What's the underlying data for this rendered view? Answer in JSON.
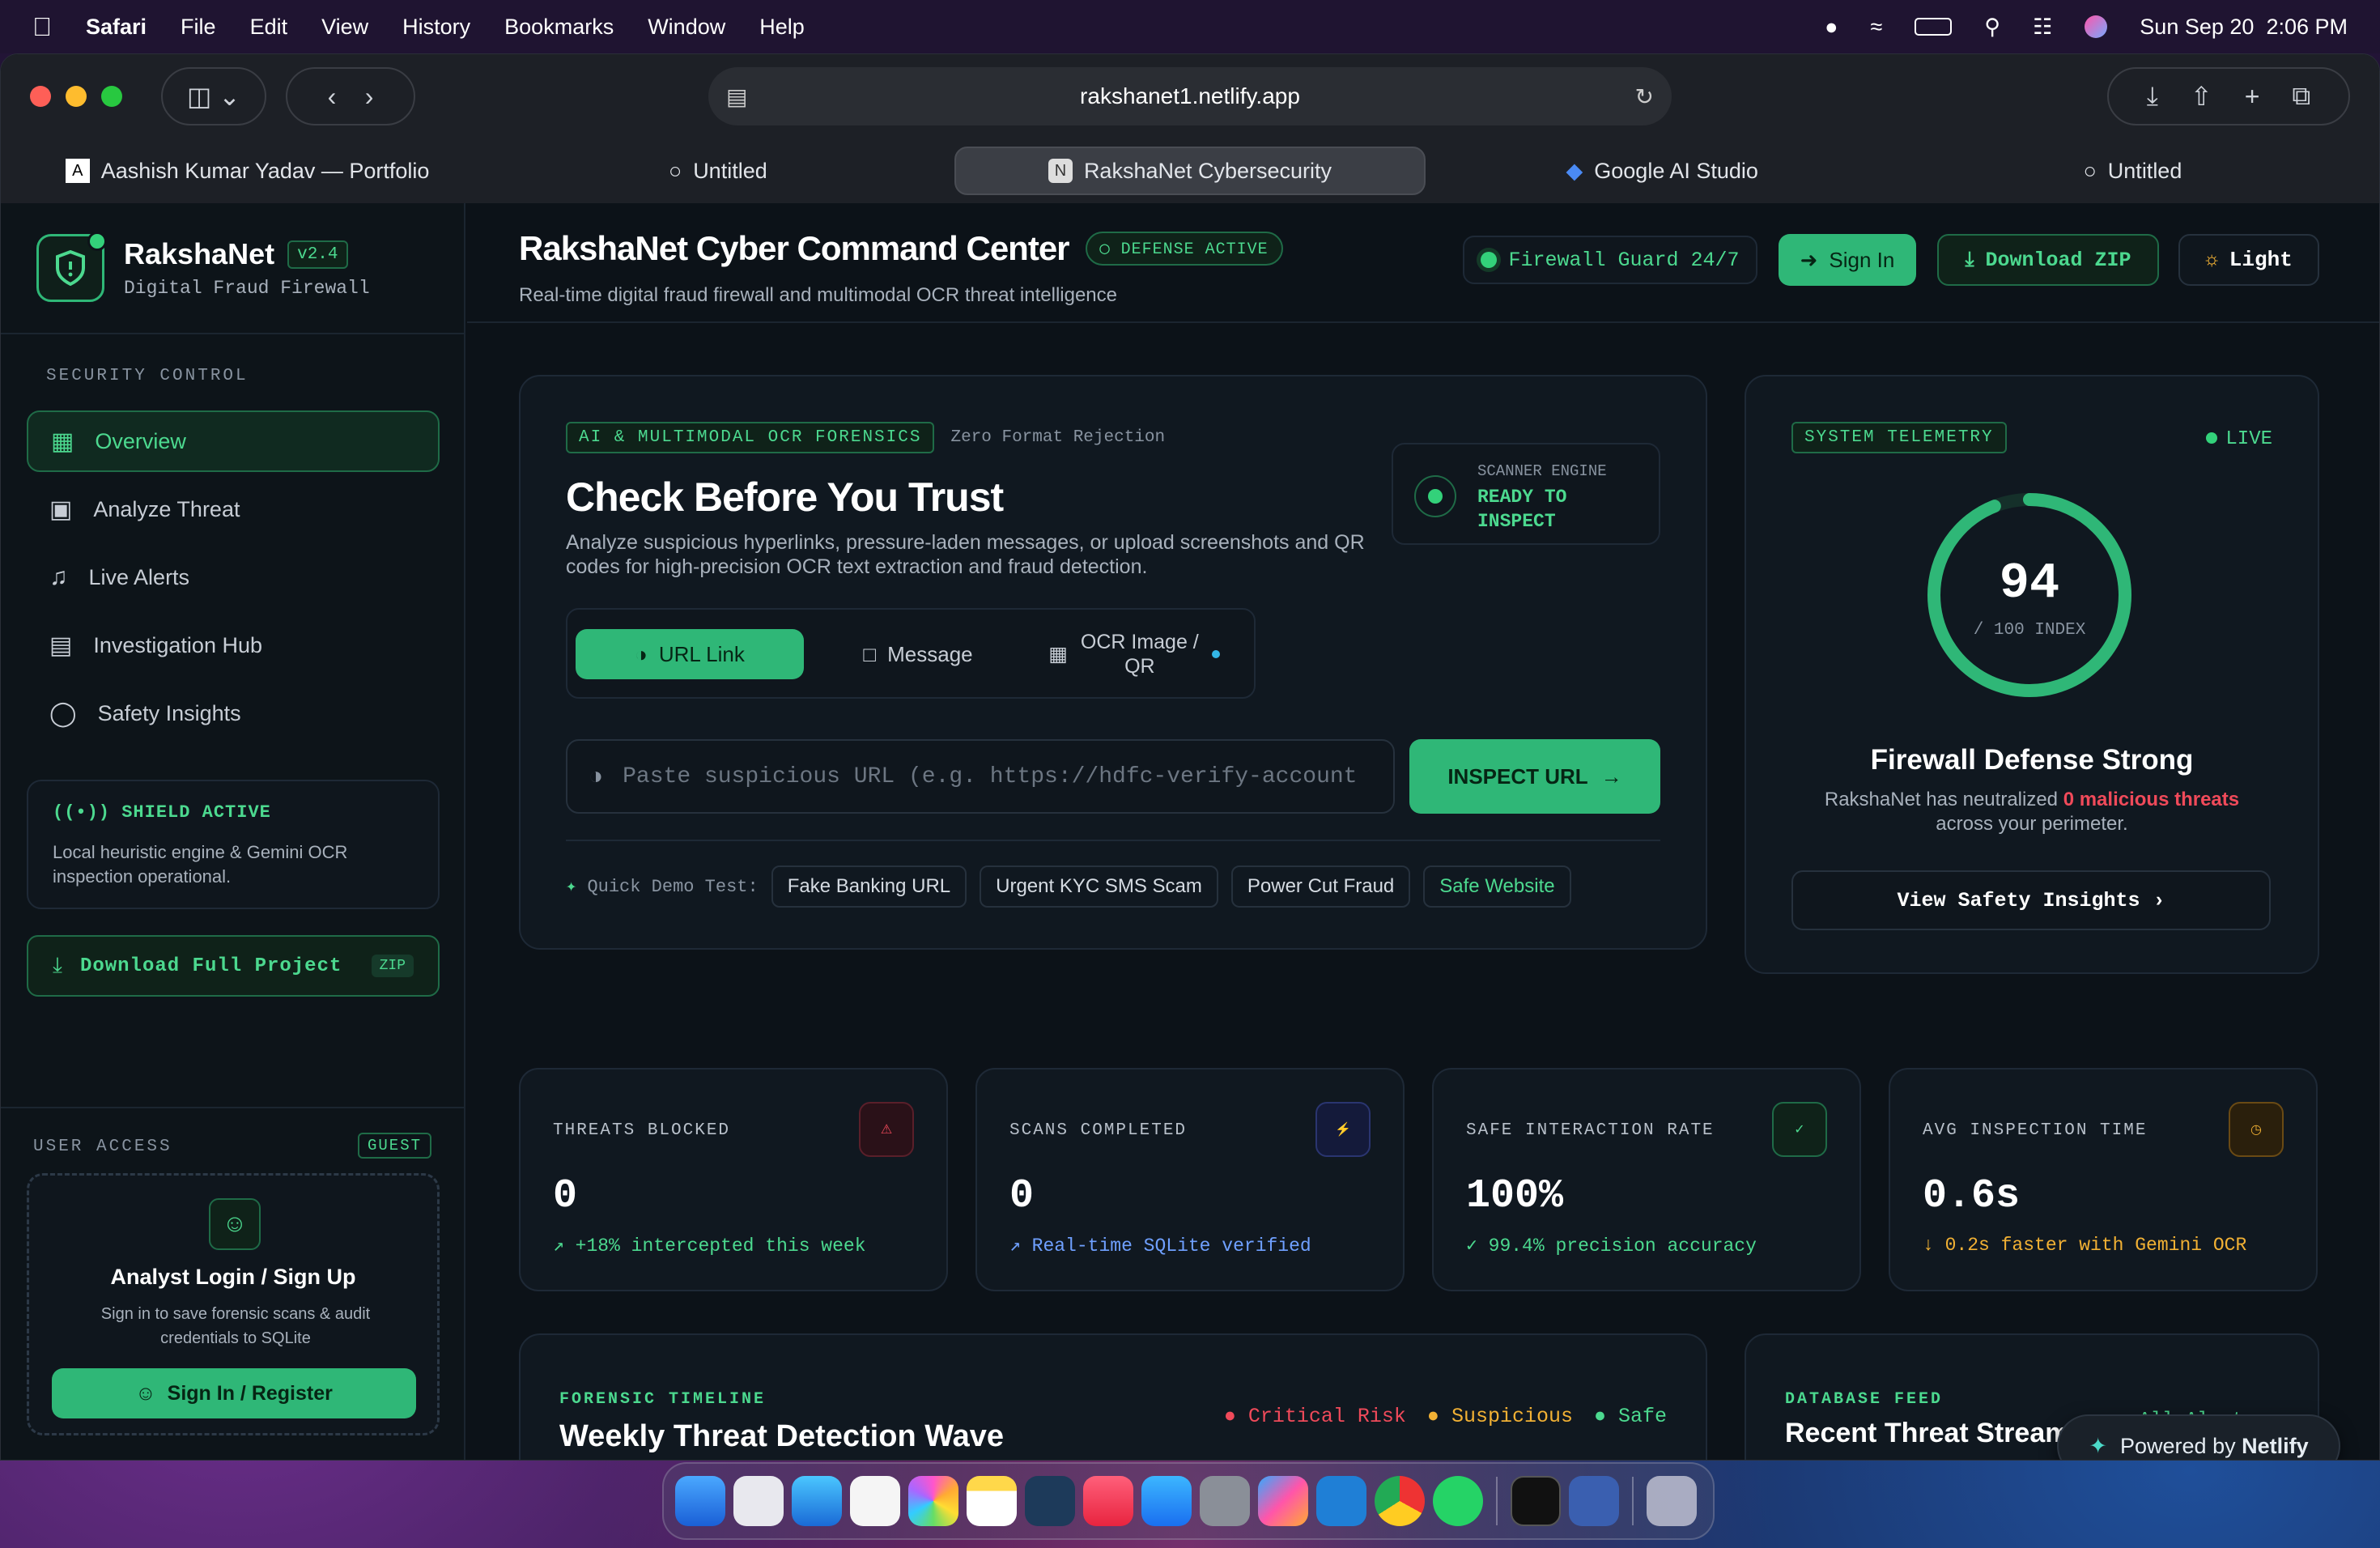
{
  "menubar": {
    "app": "Safari",
    "items": [
      "File",
      "Edit",
      "View",
      "History",
      "Bookmarks",
      "Window",
      "Help"
    ],
    "date": "Sun Sep 20",
    "time": "2:06 PM"
  },
  "browser": {
    "url": "rakshanet1.netlify.app",
    "tabs": [
      {
        "label": "Aashish Kumar Yadav — Portfolio",
        "favicon": "A"
      },
      {
        "label": "Untitled"
      },
      {
        "label": "RakshaNet Cybersecurity",
        "favicon": "N"
      },
      {
        "label": "Google AI Studio"
      },
      {
        "label": "Untitled"
      }
    ]
  },
  "brand": {
    "name": "RakshaNet",
    "version": "v2.4",
    "tagline": "Digital Fraud Firewall"
  },
  "sidebar": {
    "section_title": "SECURITY CONTROL",
    "items": [
      {
        "label": "Overview",
        "icon": "grid-icon"
      },
      {
        "label": "Analyze Threat",
        "icon": "scan-icon"
      },
      {
        "label": "Live Alerts",
        "icon": "bell-icon"
      },
      {
        "label": "Investigation Hub",
        "icon": "file-icon"
      },
      {
        "label": "Safety Insights",
        "icon": "bulb-icon"
      }
    ],
    "shield": {
      "title": "SHIELD ACTIVE",
      "text": "Local heuristic engine & Gemini OCR inspection operational."
    },
    "download": {
      "label": "Download Full Project",
      "tag": "ZIP"
    },
    "user": {
      "title": "USER ACCESS",
      "badge": "GUEST",
      "heading": "Analyst Login / Sign Up",
      "text": "Sign in to save forensic scans & audit credentials to SQLite",
      "button": "Sign In / Register"
    }
  },
  "header": {
    "title": "RakshaNet Cyber Command Center",
    "badge": "DEFENSE ACTIVE",
    "subtitle": "Real-time digital fraud firewall and multimodal OCR threat intelligence",
    "firewall": "Firewall Guard 24/7",
    "signin": "Sign In",
    "download": "Download ZIP",
    "theme": "Light"
  },
  "inspect": {
    "badge": "AI & MULTIMODAL OCR FORENSICS",
    "badge_note": "Zero Format Rejection",
    "title": "Check Before You Trust",
    "desc": "Analyze suspicious hyperlinks, pressure-laden messages, or upload screenshots and QR codes for high-precision OCR text extraction and fraud detection.",
    "engine": {
      "label": "SCANNER ENGINE",
      "status1": "READY TO",
      "status2": "INSPECT"
    },
    "tabs": [
      "URL Link",
      "Message",
      "OCR Image / QR"
    ],
    "placeholder": "Paste suspicious URL (e.g. https://hdfc-verify-account",
    "button": "INSPECT URL",
    "demo_label": "Quick Demo Test:",
    "demos": [
      "Fake Banking URL",
      "Urgent KYC SMS Scam",
      "Power Cut Fraud",
      "Safe Website"
    ]
  },
  "telemetry": {
    "badge": "SYSTEM TELEMETRY",
    "live": "LIVE",
    "score": "94",
    "score_sub": "/ 100 INDEX",
    "score_fraction": 0.94,
    "title": "Firewall Defense Strong",
    "text_pre": "RakshaNet has neutralized ",
    "text_hl": "0 malicious threats",
    "text_post": "across your perimeter.",
    "button": "View Safety Insights"
  },
  "stats": [
    {
      "label": "THREATS BLOCKED",
      "value": "0",
      "sub": "↗ +18% intercepted this week",
      "color": "#33d17a",
      "icon": "shield-alert-icon"
    },
    {
      "label": "SCANS COMPLETED",
      "value": "0",
      "sub": "↗ Real-time SQLite verified",
      "color": "#5b8cff",
      "icon": "bolt-icon"
    },
    {
      "label": "SAFE INTERACTION RATE",
      "value": "100%",
      "sub": "✓ 99.4% precision accuracy",
      "color": "#33d17a",
      "icon": "shield-check-icon"
    },
    {
      "label": "AVG INSPECTION TIME",
      "value": "0.6s",
      "sub": "↓ 0.2s faster with Gemini OCR",
      "color": "#f2b134",
      "icon": "clock-icon"
    }
  ],
  "timeline": {
    "label": "FORENSIC TIMELINE",
    "title": "Weekly Threat Detection Wave",
    "legend": [
      {
        "label": "Critical Risk",
        "color": "#f04a5a"
      },
      {
        "label": "Suspicious",
        "color": "#f2b134"
      },
      {
        "label": "Safe",
        "color": "#33d17a"
      }
    ]
  },
  "feed": {
    "label": "DATABASE FEED",
    "title": "Recent Threat Stream",
    "link": "All Alerts →"
  },
  "netlify": {
    "pre": "Powered by ",
    "brand": "Netlify"
  }
}
